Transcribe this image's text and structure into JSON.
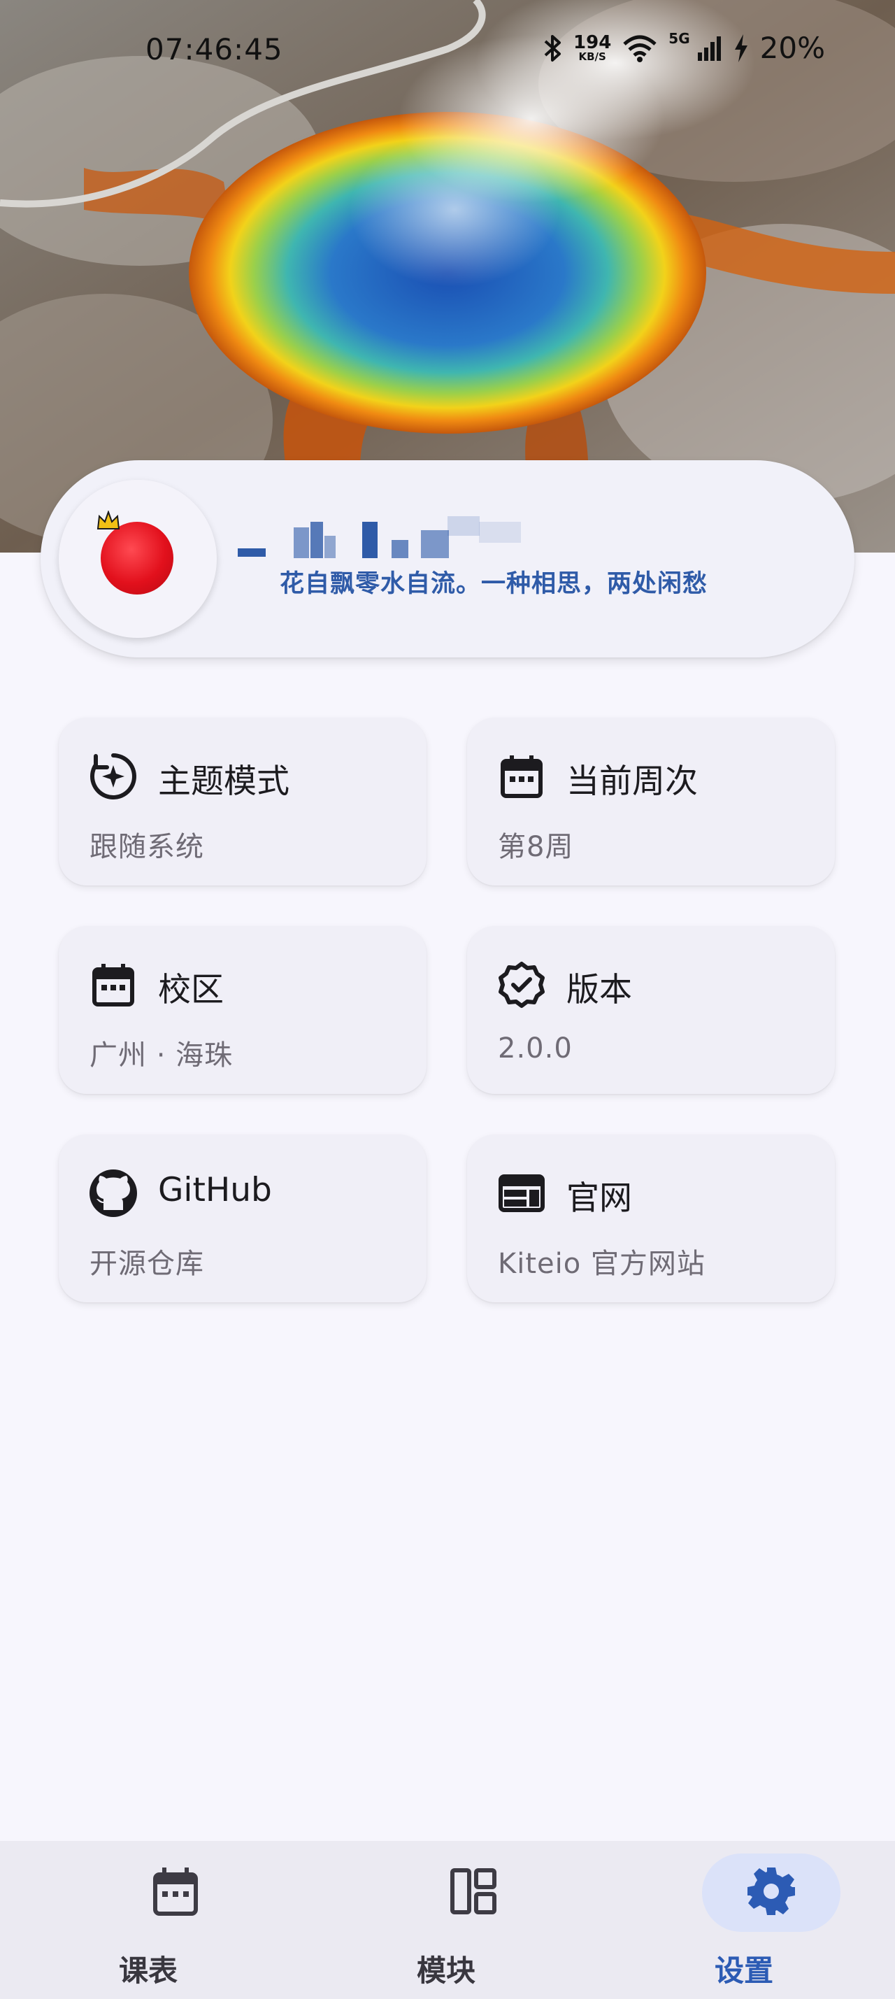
{
  "status_bar": {
    "time": "07:46:45",
    "speed_value": "194",
    "speed_unit": "KB/S",
    "network": "5G",
    "battery": "20%"
  },
  "profile": {
    "motto": "花自飘零水自流。一种相思，两处闲愁"
  },
  "tiles": [
    {
      "title": "主题模式",
      "subtitle": "跟随系统",
      "icon": "theme-auto-icon"
    },
    {
      "title": "当前周次",
      "subtitle": "第8周",
      "icon": "calendar-icon"
    },
    {
      "title": "校区",
      "subtitle": "广州 · 海珠",
      "icon": "calendar-icon"
    },
    {
      "title": "版本",
      "subtitle": "2.0.0",
      "icon": "verified-badge-icon"
    },
    {
      "title": "GitHub",
      "subtitle": "开源仓库",
      "icon": "github-icon"
    },
    {
      "title": "官网",
      "subtitle": "Kiteio 官方网站",
      "icon": "web-icon"
    }
  ],
  "bottom_nav": [
    {
      "label": "课表",
      "icon": "calendar-icon",
      "active": false
    },
    {
      "label": "模块",
      "icon": "dashboard-icon",
      "active": false
    },
    {
      "label": "设置",
      "icon": "gear-icon",
      "active": true
    }
  ],
  "colors": {
    "accent": "#2c5bb4",
    "background": "#f7f6fd",
    "tile": "#f0eff7",
    "nav_active_pill": "#dbe2f9"
  }
}
